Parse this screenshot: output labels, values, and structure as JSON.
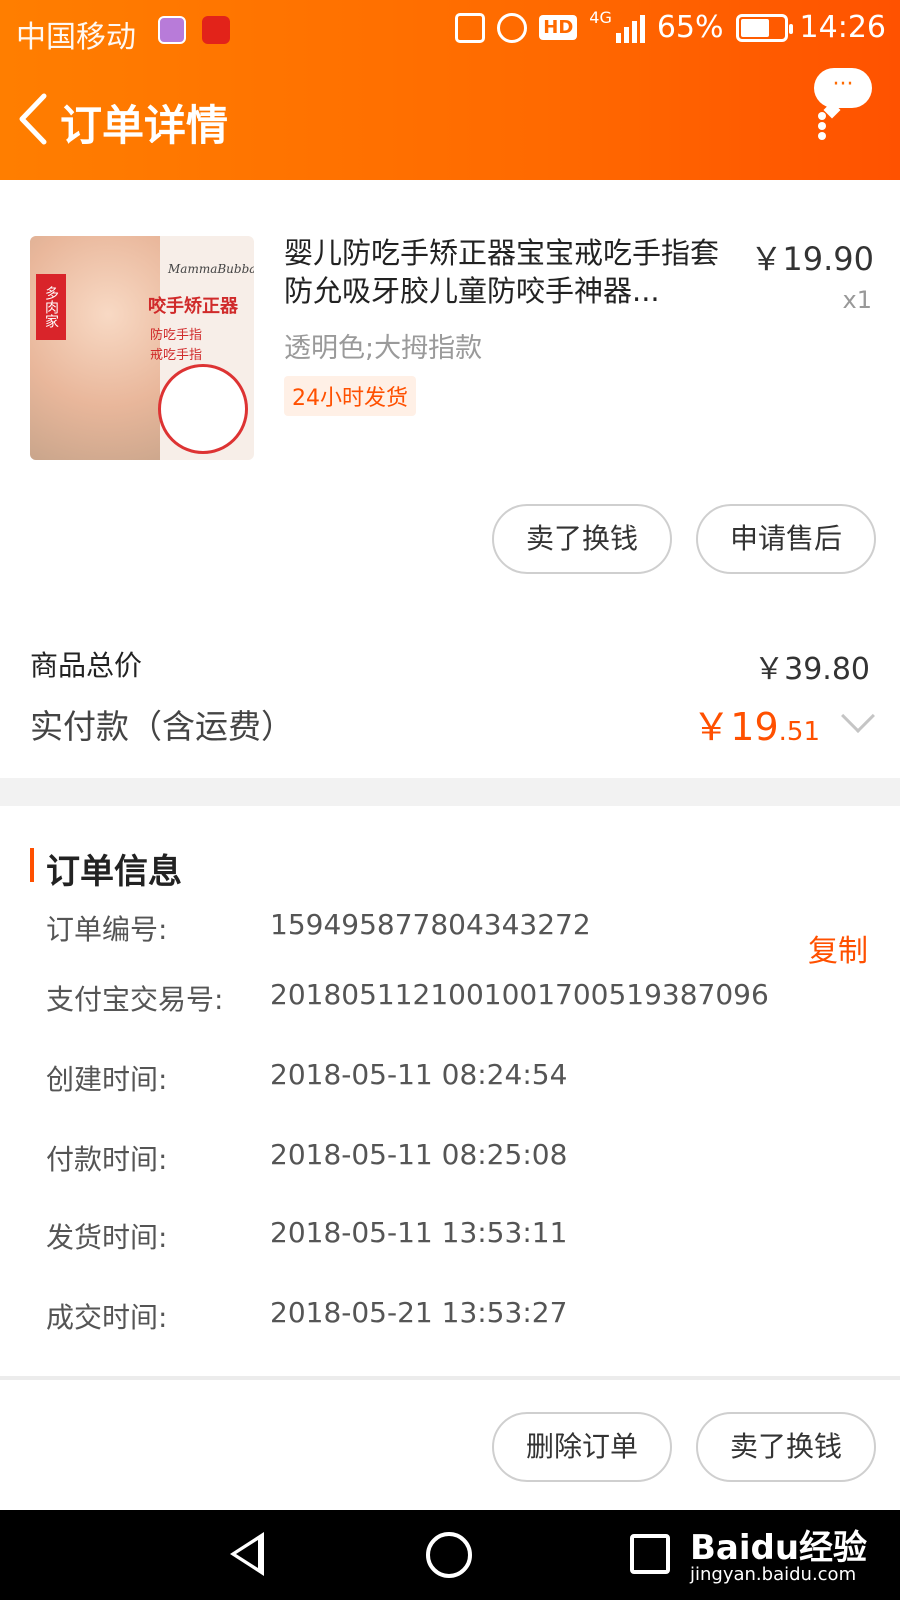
{
  "status_bar": {
    "carrier": "中国移动",
    "network": "4G",
    "battery": "65%",
    "battery_level": 0.65,
    "time": "14:26",
    "hd_label": "HD"
  },
  "header": {
    "title": "订单详情",
    "bubble_text": "···"
  },
  "product": {
    "title": "婴儿防吃手矫正器宝宝戒吃手指套防允吸牙胶儿童防咬手神器...",
    "price": "￥19.90",
    "quantity": "x1",
    "spec": "透明色;大拇指款",
    "ship_tag": "24小时发货",
    "image": {
      "tag": "多肉家",
      "brand": "MammaBubba",
      "line1": "咬手矫正器",
      "line2": "防吃手指",
      "line3": "戒吃手指"
    },
    "buttons": {
      "sell": "卖了换钱",
      "after_sale": "申请售后"
    }
  },
  "totals": {
    "goods_total_label": "商品总价",
    "goods_total_value": "￥39.80",
    "paid_label": "实付款（含运费）",
    "paid_currency": "￥",
    "paid_int": "19",
    "paid_dec": ".51"
  },
  "order_info": {
    "title": "订单信息",
    "copy_label": "复制",
    "rows": [
      {
        "label": "订单编号:",
        "value": "159495877804343272"
      },
      {
        "label": "支付宝交易号:",
        "value": "2018051121001001700519387096"
      },
      {
        "label": "创建时间:",
        "value": "2018-05-11 08:24:54"
      },
      {
        "label": "付款时间:",
        "value": "2018-05-11 08:25:08"
      },
      {
        "label": "发货时间:",
        "value": "2018-05-11 13:53:11"
      },
      {
        "label": "成交时间:",
        "value": "2018-05-21 13:53:27"
      }
    ]
  },
  "footer": {
    "delete": "删除订单",
    "sell": "卖了换钱"
  },
  "watermark": {
    "brand": "Baidu经验",
    "url": "jingyan.baidu.com"
  },
  "colors": {
    "accent": "#ff5000",
    "header_start": "#ff7e00",
    "header_end": "#ff5200"
  }
}
